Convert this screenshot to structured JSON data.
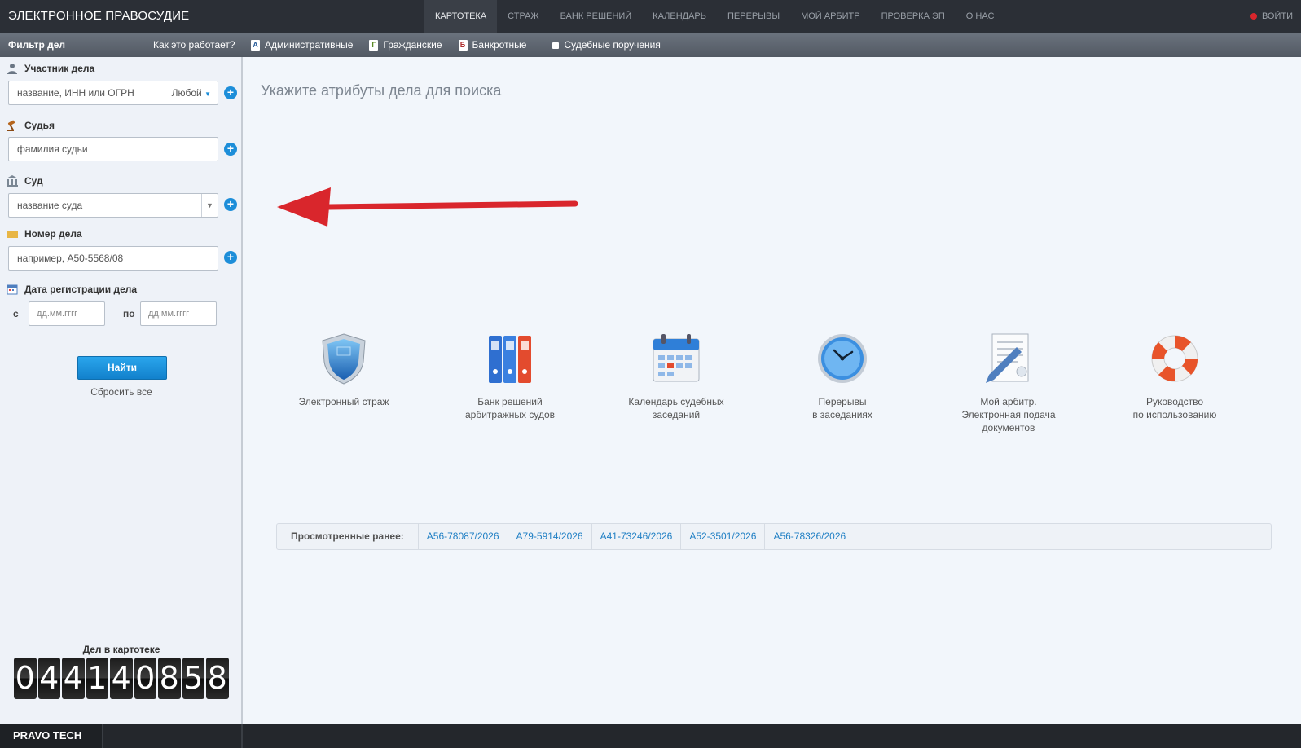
{
  "header": {
    "brand": "ЭЛЕКТРОННОЕ ПРАВОСУДИЕ",
    "nav": [
      "КАРТОТЕКА",
      "СТРАЖ",
      "БАНК РЕШЕНИЙ",
      "КАЛЕНДАРЬ",
      "ПЕРЕРЫВЫ",
      "МОЙ АРБИТР",
      "ПРОВЕРКА ЭП",
      "О НАС"
    ],
    "active_nav": "КАРТОТЕКА",
    "login": "ВОЙТИ"
  },
  "filterbar": {
    "title": "Фильтр дел",
    "how": "Как это работает?",
    "types": [
      {
        "icon": "A",
        "label": "Административные"
      },
      {
        "icon": "Г",
        "label": "Гражданские"
      },
      {
        "icon": "Б",
        "label": "Банкротные"
      },
      {
        "icon": "",
        "label": "Судебные поручения"
      }
    ]
  },
  "sidebar": {
    "participant_label": "Участник дела",
    "participant_placeholder": "название, ИНН или ОГРН",
    "participant_role": "Любой",
    "judge_label": "Судья",
    "judge_placeholder": "фамилия судьи",
    "court_label": "Суд",
    "court_placeholder": "название суда",
    "case_label": "Номер дела",
    "case_placeholder": "например, А50-5568/08",
    "date_label": "Дата регистрации дела",
    "date_from_label": "с",
    "date_to_label": "по",
    "date_from_placeholder": "дд.мм.гггг",
    "date_to_placeholder": "дд.мм.гггг",
    "find_button": "Найти",
    "reset": "Сбросить все",
    "counter_label": "Дел в картотеке",
    "counter_digits": [
      "0",
      "4",
      "4",
      "1",
      "4",
      "0",
      "8",
      "5",
      "8"
    ]
  },
  "main": {
    "title": "Укажите атрибуты дела для поиска",
    "services": [
      {
        "icon": "shield-icon",
        "lines": [
          "Электронный страж"
        ]
      },
      {
        "icon": "folders-icon",
        "lines": [
          "Банк решений",
          "арбитражных судов"
        ]
      },
      {
        "icon": "calendar-icon",
        "lines": [
          "Календарь судебных",
          "заседаний"
        ]
      },
      {
        "icon": "clock-icon",
        "lines": [
          "Перерывы",
          "в заседаниях"
        ]
      },
      {
        "icon": "document-pen-icon",
        "lines": [
          "Мой арбитр.",
          "Электронная подача",
          "документов"
        ]
      },
      {
        "icon": "lifebuoy-icon",
        "lines": [
          "Руководство",
          "по использованию"
        ]
      }
    ],
    "history_label": "Просмотренные ранее:",
    "history": [
      "А56-78087/2026",
      "А79-5914/2026",
      "А41-73246/2026",
      "А52-3501/2026",
      "А56-78326/2026"
    ]
  },
  "footer": {
    "brand": "PRAVO TECH"
  },
  "colors": {
    "accent": "#1d8ed9",
    "arrow": "#d9262c",
    "topbar": "#2b2f36"
  }
}
